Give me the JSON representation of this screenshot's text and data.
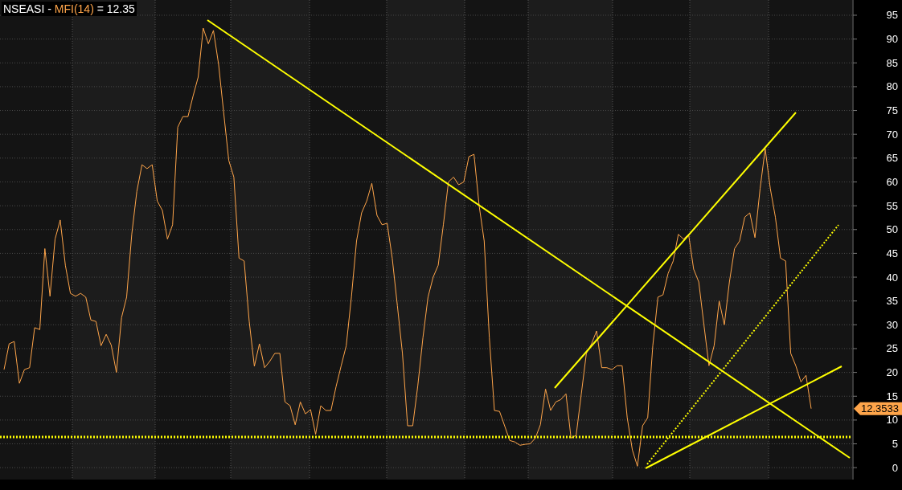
{
  "legend": {
    "symbol": "NSEASI",
    "separator": "-",
    "value": "= 12.35"
  },
  "last_value_label": "12.3533",
  "trend_lines": [
    {
      "dotted": false
    },
    {
      "dotted": false
    },
    {
      "dotted": false
    },
    {
      "dotted": true
    },
    {
      "dotted": true
    }
  ],
  "chart_data": {
    "type": "line",
    "grid": true,
    "ylim": [
      -2.5,
      98.2
    ],
    "yticks": [
      0,
      5,
      10,
      15,
      20,
      25,
      30,
      35,
      40,
      45,
      50,
      55,
      60,
      65,
      70,
      75,
      80,
      85,
      90,
      95
    ],
    "categories": [
      null,
      null,
      null,
      null,
      null,
      null,
      null,
      null,
      null,
      null,
      null,
      null,
      null,
      null,
      null,
      null,
      null,
      null,
      null,
      null,
      null,
      null,
      null,
      null,
      null,
      null,
      null,
      null,
      null,
      null,
      null,
      null,
      null,
      null,
      null,
      null,
      null,
      null,
      null,
      null,
      null,
      null,
      null,
      null,
      null,
      null,
      null,
      null,
      null,
      null,
      null,
      null,
      null,
      null,
      null,
      null,
      null,
      null,
      null,
      null,
      null,
      null,
      null,
      null,
      null,
      null,
      null,
      null,
      null,
      null,
      null,
      null,
      null,
      null,
      null,
      null,
      null,
      null,
      null,
      null,
      null,
      null,
      null,
      null,
      null,
      null,
      null,
      null,
      null,
      null,
      null,
      null,
      null,
      null,
      null,
      null,
      null,
      null,
      null,
      null,
      null,
      null,
      null,
      null,
      null,
      null,
      null,
      null,
      null,
      null,
      null,
      null,
      null,
      null,
      null,
      null,
      null,
      null,
      null,
      null,
      null,
      null,
      null,
      null,
      null,
      null,
      null,
      null,
      null,
      null,
      null,
      null,
      null,
      null,
      null,
      null,
      null,
      null,
      null,
      null,
      null,
      null,
      null,
      null,
      null,
      null,
      null,
      null,
      null,
      null,
      null,
      null,
      null,
      null,
      null,
      null,
      null,
      null,
      null
    ],
    "series": [
      {
        "name": "MFI(14)",
        "color": "#ffa54a",
        "values": [
          20.6,
          26,
          26.5,
          17.7,
          20.6,
          21,
          29.4,
          29,
          46,
          36,
          48,
          52,
          42.5,
          36.6,
          36,
          36.6,
          35.8,
          31,
          30.7,
          25.6,
          28,
          25.7,
          20,
          31.5,
          35.8,
          49,
          58,
          63.6,
          62.8,
          63.6,
          56,
          54,
          48,
          51,
          71.5,
          73.7,
          73.7,
          78,
          82,
          92.3,
          89,
          91.8,
          84.7,
          74.6,
          64.5,
          61,
          44,
          43.4,
          30.7,
          21.3,
          26,
          21,
          22.3,
          24,
          24,
          13.8,
          13,
          9,
          13.8,
          11.3,
          12.2,
          7,
          13,
          12,
          12,
          17,
          21.4,
          25.6,
          35.8,
          47.6,
          53.5,
          56,
          59.7,
          53,
          51,
          51.3,
          44,
          34,
          24,
          8.8,
          8.8,
          17.2,
          27.3,
          35.8,
          40,
          42.5,
          51,
          60,
          61,
          59.4,
          60,
          65.3,
          65.8,
          55,
          47.6,
          27.3,
          12,
          11.8,
          8.8,
          5.7,
          5.4,
          4.7,
          4.9,
          5,
          6.2,
          9,
          16.5,
          12,
          13.8,
          14.3,
          15.5,
          6.2,
          6.8,
          15.5,
          24,
          26,
          28.7,
          21,
          21,
          20.6,
          21.4,
          21.4,
          10.5,
          3.7,
          0.3,
          8.8,
          10.5,
          25.6,
          35.8,
          36.3,
          40.8,
          43.4,
          49,
          48,
          49,
          41.7,
          39,
          30,
          21.4,
          25.6,
          35,
          30,
          39,
          46,
          47.6,
          52.6,
          53.5,
          48.3,
          58.6,
          67,
          58.6,
          52.6,
          44,
          43.4,
          24,
          21.4,
          18,
          19.4,
          12.4
        ]
      }
    ]
  }
}
